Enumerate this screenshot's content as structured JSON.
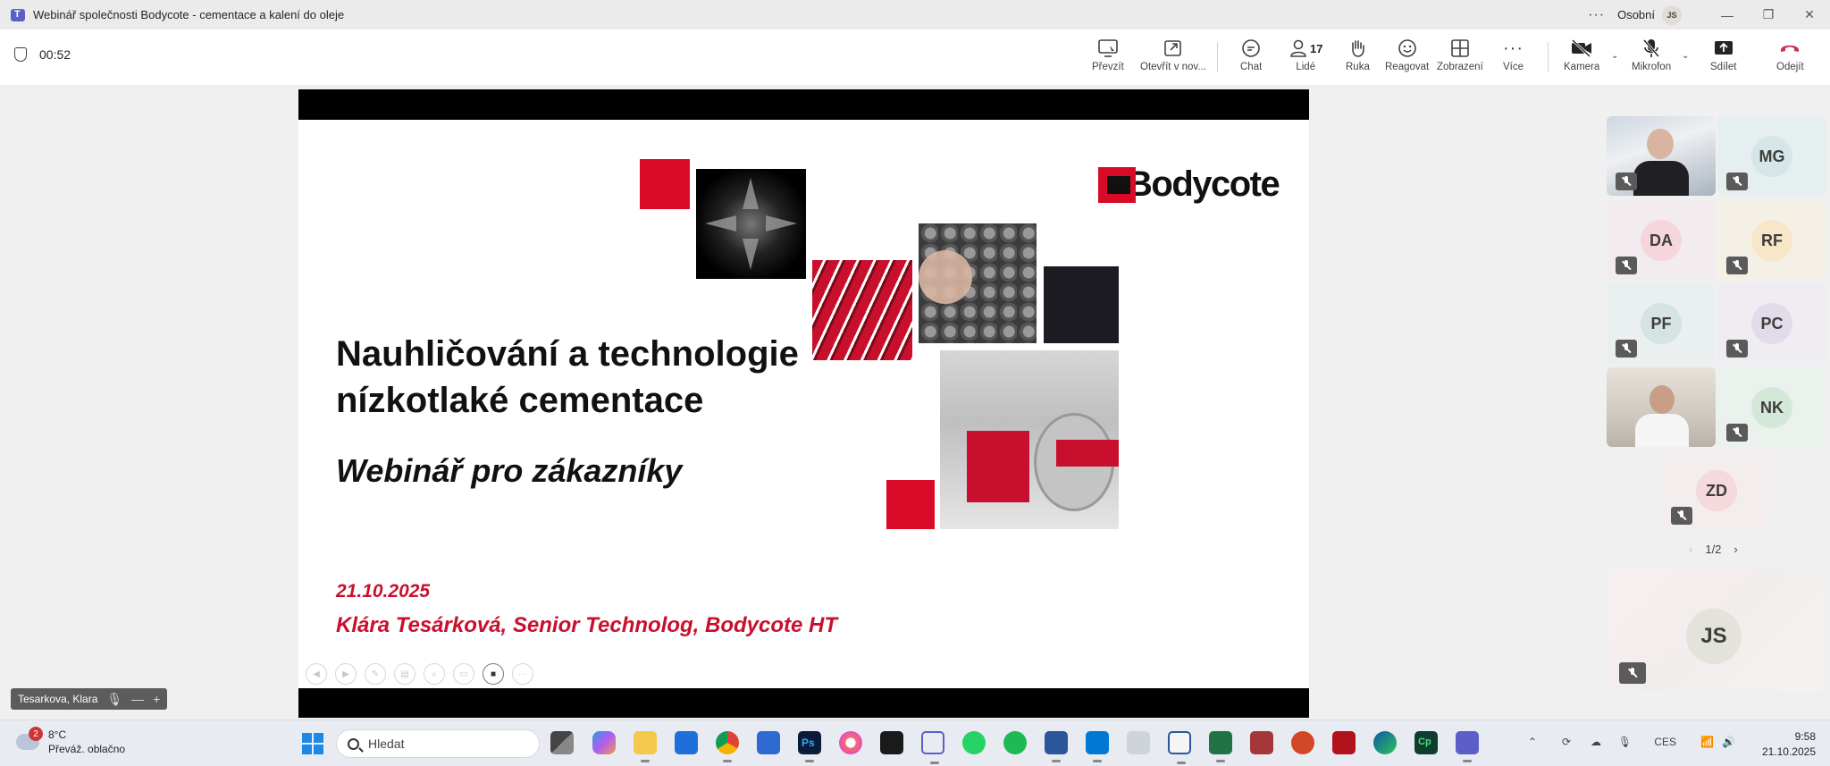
{
  "window": {
    "title": "Webinář společnosti Bodycote - cementace a kalení do oleje",
    "profile_label": "Osobní",
    "profile_initials": "JS"
  },
  "meeting": {
    "timer": "00:52",
    "toolbar": {
      "take_control": "Převzít",
      "open_new": "Otevřít v nov...",
      "chat": "Chat",
      "people": "Lidé",
      "people_count": "17",
      "raise_hand": "Ruka",
      "react": "Reagovat",
      "view": "Zobrazení",
      "more": "Více",
      "camera": "Kamera",
      "mic": "Mikrofon",
      "share": "Sdílet",
      "leave": "Odejít"
    }
  },
  "slide": {
    "title_line1": "Nauhličování a technologie",
    "title_line2": "nízkotlaké cementace",
    "subtitle": "Webinář pro zákazníky",
    "date": "21.10.2025",
    "author": "Klára Tesárková, Senior Technolog, Bodycote HT",
    "logo_text": "Bodycote"
  },
  "participants": [
    {
      "initials": "",
      "video": true,
      "bg": "#dfe3e8"
    },
    {
      "initials": "MG",
      "bg": "#e6efef",
      "avatar": "#d6e6e8"
    },
    {
      "initials": "DA",
      "bg": "#f3ecef",
      "avatar": "#f6d6db"
    },
    {
      "initials": "RF",
      "bg": "#f4f0e6",
      "avatar": "#f7e6c8"
    },
    {
      "initials": "PF",
      "bg": "#eaf0ef",
      "avatar": "#d5e3e2"
    },
    {
      "initials": "PC",
      "bg": "#efedf2",
      "avatar": "#e2dcea"
    },
    {
      "initials": "",
      "video": true,
      "bg": "#d9d4cc"
    },
    {
      "initials": "NK",
      "bg": "#ebf1ec",
      "avatar": "#d4e8da"
    },
    {
      "initials": "ZD",
      "bg": "#f3eded",
      "avatar": "#f5d9dc"
    }
  ],
  "pager": "1/2",
  "self": {
    "initials": "JS"
  },
  "presenter": {
    "name": "Tesarkova, Klara"
  },
  "taskbar": {
    "weather_temp": "8°C",
    "weather_desc": "Převáž. oblačno",
    "weather_badge": "2",
    "search_placeholder": "Hledat",
    "lang": "CES",
    "time": "9:58",
    "date": "21.10.2025"
  },
  "colors": {
    "accent_red": "#d90a27",
    "teams": "#5b5fc7",
    "leave": "#c4314b"
  }
}
